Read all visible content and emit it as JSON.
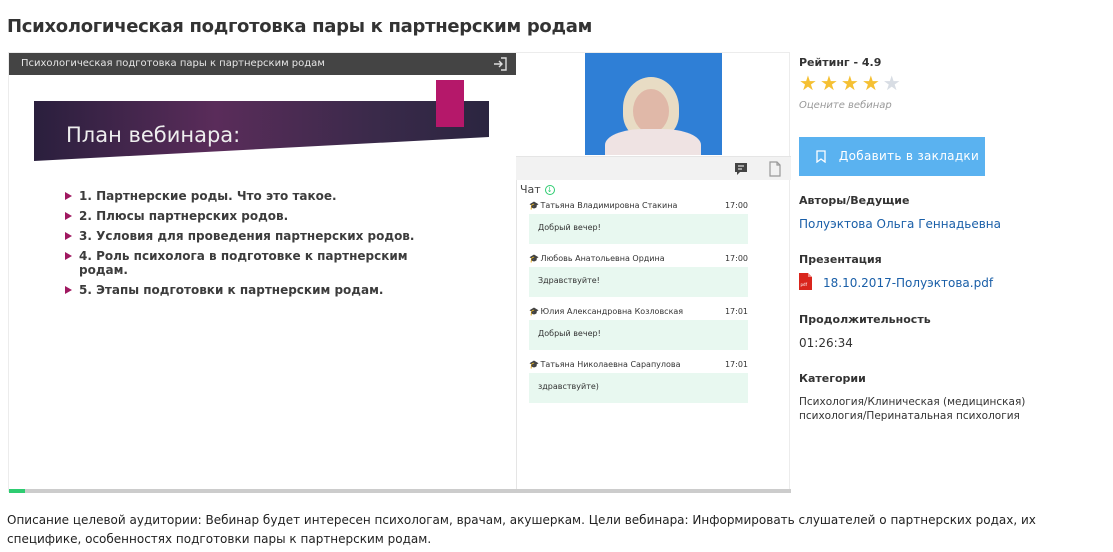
{
  "page": {
    "title": "Психологическая подготовка пары к партнерским родам"
  },
  "player": {
    "bar_title": "Психологическая подготовка пары к партнерским родам",
    "progress_fraction": 0.02,
    "slide": {
      "heading": "План вебинара:",
      "items": [
        "1. Партнерские роды. Что это такое.",
        "2. Плюсы партнерских родов.",
        "3. Условия для проведения  партнерских родов.",
        "4. Роль психолога в подготовке к партнерским родам.",
        "5. Этапы подготовки к партнерским родам."
      ],
      "accent_color": "#b5186a"
    },
    "chat": {
      "label": "Чат",
      "messages": [
        {
          "author": "Татьяна Владимировна Стакина",
          "time": "17:00",
          "text": "Добрый вечер!"
        },
        {
          "author": "Любовь Анатольевна Ордина",
          "time": "17:00",
          "text": "Здравствуйте!"
        },
        {
          "author": "Юлия Александровна Козловская",
          "time": "17:01",
          "text": "Добрый вечер!"
        },
        {
          "author": "Татьяна Николаевна Сарапулова",
          "time": "17:01",
          "text": "здравствуйте)"
        }
      ]
    }
  },
  "sidebar": {
    "rating_label": "Рейтинг - 4.9",
    "stars_filled": 4,
    "stars_total": 5,
    "rate_hint": "Оцените вебинар",
    "bookmark_label": "Добавить в закладки",
    "authors_label": "Авторы/Ведущие",
    "author_name": "Полуэктова Ольга Геннадьевна",
    "presentation_label": "Презентация",
    "presentation_file": "18.10.2017-Полуэктова.pdf",
    "duration_label": "Продолжительность",
    "duration_value": "01:26:34",
    "categories_label": "Категории",
    "categories_value": "Психология/Клиническая (медицинская) психология/Перинатальная психология"
  },
  "description": "Описание целевой аудитории: Вебинар будет интересен психологам, врачам, акушеркам. Цели вебинара: Информировать слушателей о партнерских родах, их специфике, особенностях подготовки пары к партнерским родам.",
  "colors": {
    "button": "#5ab2f0",
    "link": "#1a5fa8",
    "star": "#f5c033",
    "chat_bubble": "#e8f8f0",
    "progress": "#2ecc71"
  }
}
